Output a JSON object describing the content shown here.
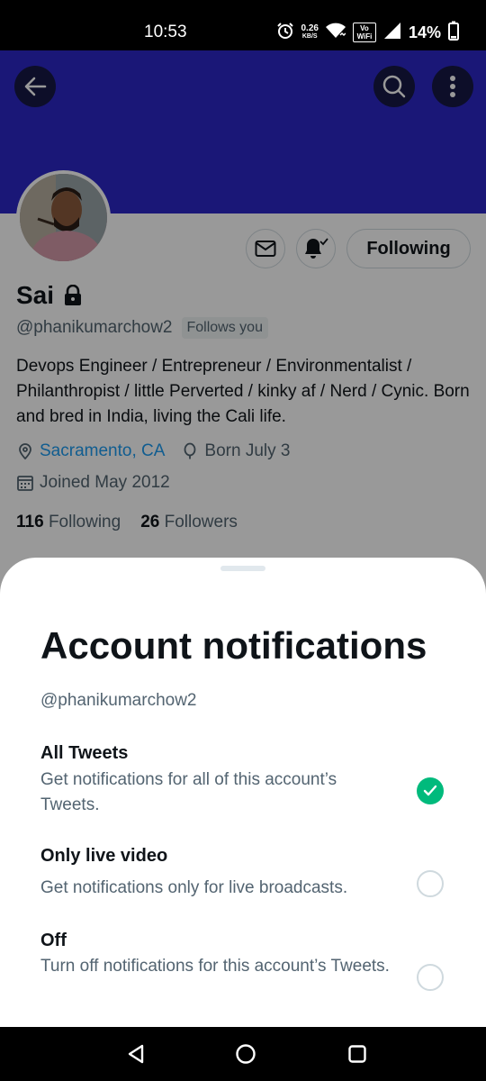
{
  "status_bar": {
    "time": "10:53",
    "net_speed_value": "0.26",
    "net_speed_unit": "KB/S",
    "volte_line1": "Vo",
    "volte_line2": "WiFi",
    "battery": "14%",
    "icons": [
      "alarm-icon",
      "wifi-icon",
      "signal-icon",
      "battery-icon"
    ]
  },
  "header": {
    "banner_color": "#2c27c6",
    "icons": [
      "back-arrow-icon",
      "search-icon",
      "more-vertical-icon"
    ]
  },
  "profile": {
    "display_name": "Sai",
    "handle": "@phanikumarchow2",
    "follows_you": "Follows you",
    "following_button": "Following",
    "bio": "Devops Engineer / Entrepreneur / Environmentalist / Philanthropist / little Perverted / kinky af / Nerd / Cynic. Born and bred in India, living the Cali life.",
    "location": "Sacramento, CA",
    "birthday": "Born July 3",
    "joined": "Joined May 2012",
    "following_count": "116",
    "following_label": "Following",
    "followers_count": "26",
    "followers_label": "Followers"
  },
  "sheet": {
    "title": "Account notifications",
    "handle": "@phanikumarchow2",
    "options": [
      {
        "title": "All Tweets",
        "description": "Get notifications for all of this account’s Tweets.",
        "selected": true
      },
      {
        "title": "Only live video",
        "description": "Get notifications only for live broadcasts.",
        "selected": false
      },
      {
        "title": "Off",
        "description": "Turn off notifications for this account’s Tweets.",
        "selected": false
      }
    ],
    "accent_color": "#00ba7c"
  },
  "nav": {
    "icons": [
      "back-triangle-icon",
      "home-circle-icon",
      "recents-square-icon"
    ]
  }
}
